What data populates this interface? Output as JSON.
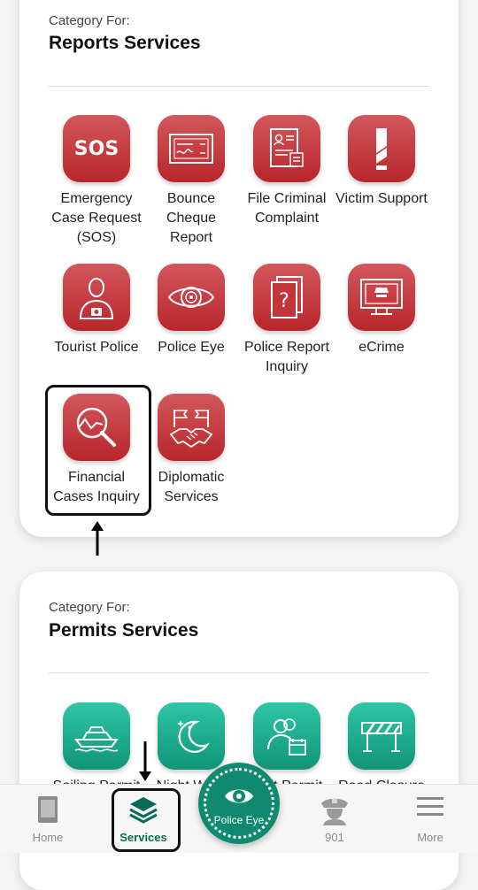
{
  "reports_card": {
    "category_label": "Category For:",
    "title": "Reports Services",
    "services": [
      {
        "label": "Emergency Case Request (SOS)",
        "icon": "sos-icon"
      },
      {
        "label": "Bounce Cheque Report",
        "icon": "cheque-icon"
      },
      {
        "label": "File Criminal Complaint",
        "icon": "complaint-document-icon"
      },
      {
        "label": "Victim Support",
        "icon": "victim-support-icon"
      },
      {
        "label": "Tourist Police",
        "icon": "tourist-police-icon"
      },
      {
        "label": "Police Eye",
        "icon": "eye-icon"
      },
      {
        "label": "Police Report Inquiry",
        "icon": "report-inquiry-icon"
      },
      {
        "label": "eCrime",
        "icon": "ecrime-monitor-icon"
      },
      {
        "label": "Financial Cases Inquiry",
        "icon": "financial-search-icon"
      },
      {
        "label": "Diplomatic Services",
        "icon": "handshake-flags-icon"
      }
    ],
    "sos_icon_text": "SOS"
  },
  "permits_card": {
    "category_label": "Category For:",
    "title": "Permits Services",
    "services": [
      {
        "label": "Sailing Permit",
        "icon": "boat-icon"
      },
      {
        "label": "Night Work",
        "icon": "moon-stars-icon"
      },
      {
        "label": "Visit Permit",
        "icon": "visitors-calendar-icon"
      },
      {
        "label": "Road Closure",
        "icon": "road-barrier-icon"
      }
    ]
  },
  "bottom_nav": {
    "items": [
      {
        "label": "Home",
        "icon": "home-tablet-icon"
      },
      {
        "label": "Services",
        "icon": "layers-icon"
      },
      {
        "label": "901",
        "icon": "police-officer-icon"
      },
      {
        "label": "More",
        "icon": "hamburger-menu-icon"
      }
    ],
    "center_button": {
      "label": "Police Eye",
      "icon": "eye-icon"
    }
  },
  "colors": {
    "report_tile": "#c2353a",
    "permit_tile": "#1aae8e",
    "active_nav": "#0b6b56",
    "center_button": "#0f8a6e"
  }
}
